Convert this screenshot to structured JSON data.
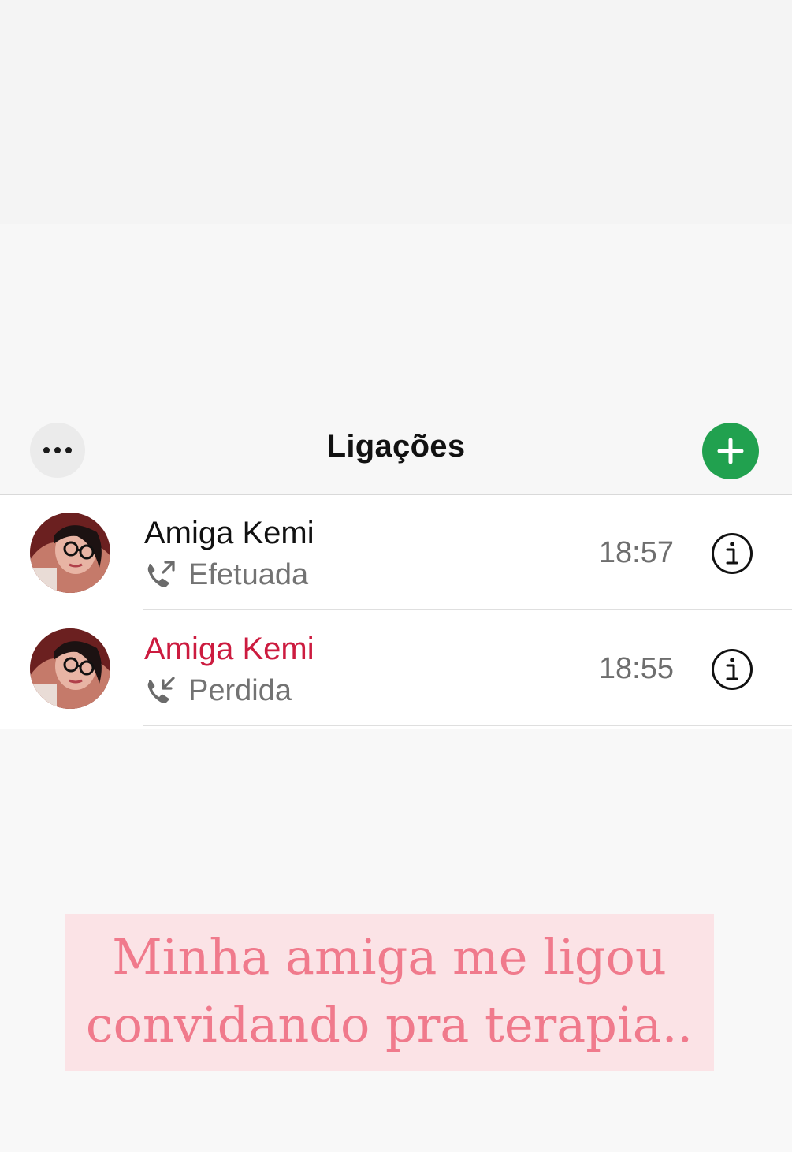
{
  "header": {
    "title": "Ligações",
    "more_icon": "ellipsis-icon",
    "new_call_icon": "plus-icon",
    "accent_color": "#21a14f"
  },
  "calls": [
    {
      "name": "Amiga Kemi",
      "type": "Efetuada",
      "type_icon": "outgoing-call-icon",
      "time": "18:57",
      "missed": false
    },
    {
      "name": "Amiga Kemi",
      "type": "Perdida",
      "type_icon": "incoming-call-icon",
      "time": "18:55",
      "missed": true,
      "missed_color": "#cc1b3f"
    }
  ],
  "caption": {
    "line1": "Minha amiga me ligou",
    "line2": "convidando pra terapia.."
  }
}
